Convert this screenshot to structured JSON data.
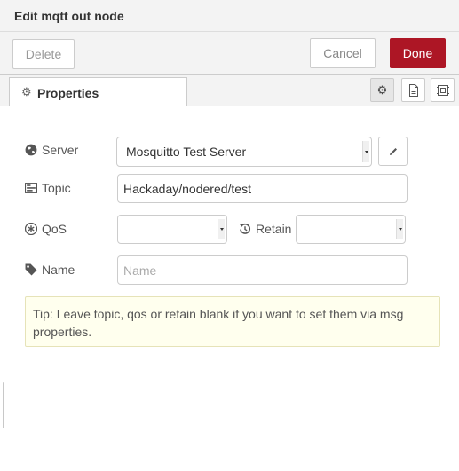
{
  "dialog": {
    "title": "Edit mqtt out node"
  },
  "buttons": {
    "delete": "Delete",
    "cancel": "Cancel",
    "done": "Done"
  },
  "tabs": {
    "properties": {
      "label": "Properties",
      "icon": "gear-icon"
    },
    "side_buttons": [
      "gear-icon",
      "document-icon",
      "appearance-icon"
    ]
  },
  "form": {
    "server": {
      "label": "Server",
      "value": "Mosquitto Test Server",
      "icon": "globe-icon"
    },
    "topic": {
      "label": "Topic",
      "value": "Hackaday/nodered/test",
      "icon": "tasks-icon"
    },
    "qos": {
      "label": "QoS",
      "value": "",
      "icon": "asterisk-icon"
    },
    "retain": {
      "label": "Retain",
      "value": "",
      "icon": "history-icon"
    },
    "name": {
      "label": "Name",
      "value": "",
      "placeholder": "Name",
      "icon": "tag-icon"
    }
  },
  "tip": "Tip: Leave topic, qos or retain blank if you want to set them via msg properties.",
  "colors": {
    "done_button": "#ad1625",
    "header_bg": "#f3f3f3",
    "tip_bg": "#ffffee"
  }
}
